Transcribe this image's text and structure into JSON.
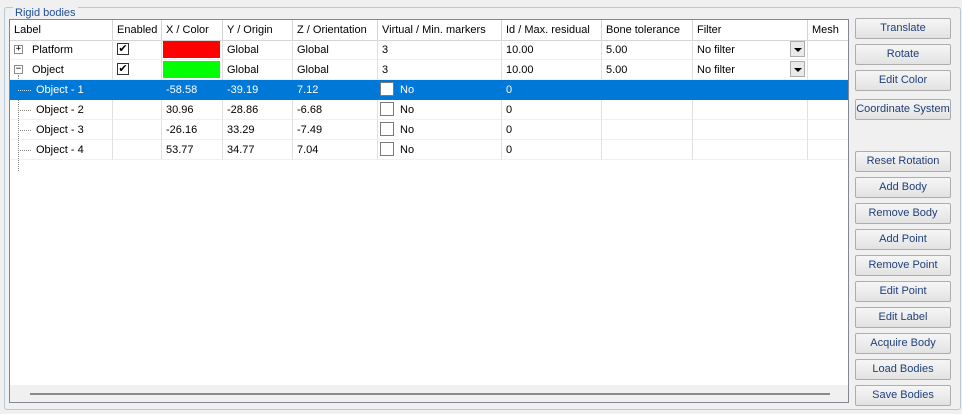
{
  "group_title": "Rigid bodies",
  "columns": [
    "Label",
    "Enabled",
    "X / Color",
    "Y / Origin",
    "Z / Orientation",
    "Virtual / Min. markers",
    "Id / Max. residual",
    "Bone tolerance",
    "Filter",
    "Mesh"
  ],
  "bodies": [
    {
      "label": "Platform",
      "expander": "+",
      "enabled": "✔",
      "color": "#ff0000",
      "origin": "Global",
      "orientation": "Global",
      "min_markers": "3",
      "max_residual": "10.00",
      "bone_tolerance": "5.00",
      "filter": "No filter"
    },
    {
      "label": "Object",
      "expander": "−",
      "enabled": "✔",
      "color": "#00ff00",
      "origin": "Global",
      "orientation": "Global",
      "min_markers": "3",
      "max_residual": "10.00",
      "bone_tolerance": "5.00",
      "filter": "No filter"
    }
  ],
  "points": [
    {
      "label": "Object - 1",
      "x": "-58.58",
      "y": "-39.19",
      "z": "7.12",
      "virtual": "No",
      "id": "0"
    },
    {
      "label": "Object - 2",
      "x": "30.96",
      "y": "-28.86",
      "z": "-6.68",
      "virtual": "No",
      "id": "0"
    },
    {
      "label": "Object - 3",
      "x": "-26.16",
      "y": "33.29",
      "z": "-7.49",
      "virtual": "No",
      "id": "0"
    },
    {
      "label": "Object - 4",
      "x": "53.77",
      "y": "34.77",
      "z": "7.04",
      "virtual": "No",
      "id": "0"
    }
  ],
  "buttons": {
    "translate": "Translate",
    "rotate": "Rotate",
    "edit_color": "Edit Color",
    "coordinate_system": "Coordinate System",
    "reset_rotation": "Reset Rotation",
    "add_body": "Add Body",
    "remove_body": "Remove Body",
    "add_point": "Add Point",
    "remove_point": "Remove Point",
    "edit_point": "Edit Point",
    "edit_label": "Edit Label",
    "acquire_body": "Acquire Body",
    "load_bodies": "Load Bodies",
    "save_bodies": "Save Bodies"
  },
  "selected_point_index": 0
}
